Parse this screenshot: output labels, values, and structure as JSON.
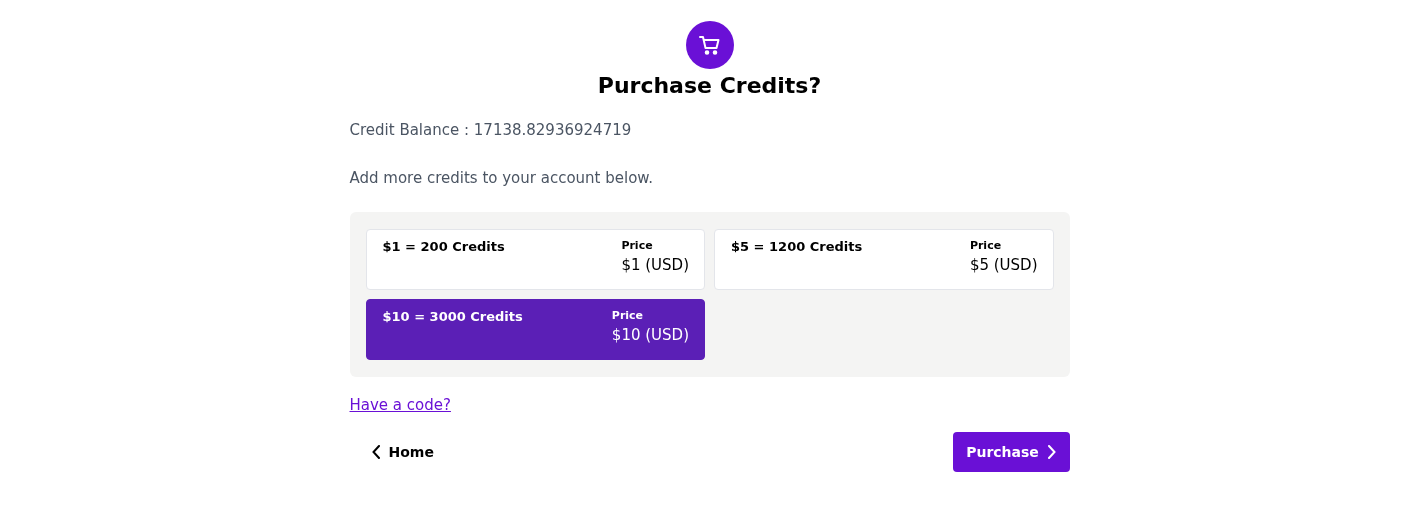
{
  "title": "Purchase Credits?",
  "balance": "Credit Balance : 17138.82936924719",
  "description": "Add more credits to your account below.",
  "packages": [
    {
      "name": "$1 = 200 Credits",
      "price_label": "Price",
      "price": "$1 (USD)",
      "selected": false
    },
    {
      "name": "$5 = 1200 Credits",
      "price_label": "Price",
      "price": "$5 (USD)",
      "selected": false
    },
    {
      "name": "$10 = 3000 Credits",
      "price_label": "Price",
      "price": "$10 (USD)",
      "selected": true
    }
  ],
  "code_link": "Have a code?",
  "back_button": "Home",
  "purchase_button": "Purchase"
}
